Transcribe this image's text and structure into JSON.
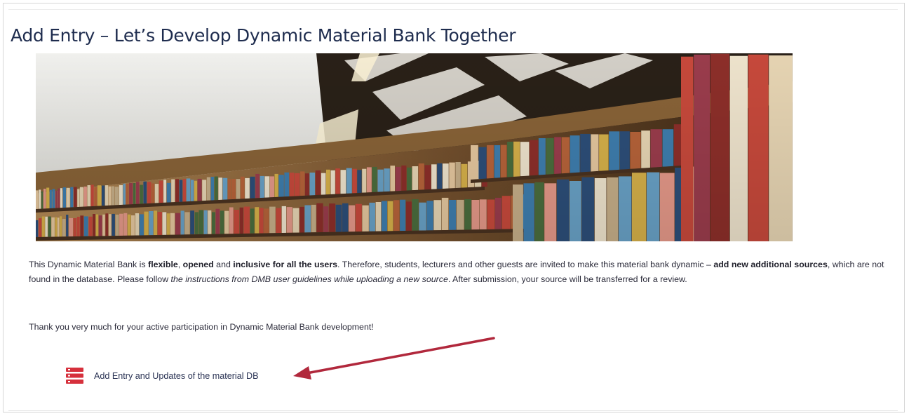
{
  "page": {
    "title": "Add Entry – Let’s Develop Dynamic Material Bank Together"
  },
  "banner": {
    "description": "library-bookshelf-photo",
    "colors": {
      "ceiling": "#ecece8",
      "wood": "#6b4a2b",
      "accent": "#c9a67a"
    }
  },
  "intro": {
    "p1": "This Dynamic Material Bank is ",
    "b1": "flexible",
    "p2": ", ",
    "b2": "opened",
    "p3": " and ",
    "b3": "inclusive for all the users",
    "p4": ". Therefore, students, lecturers and other guests are invited to make this material bank dynamic – ",
    "b4": "add new additional sources",
    "p5": ", which are not found in the database. Please follow ",
    "i1": "the instructions from DMB user guidelines while uploading a new source",
    "p6": ". After submission, your source will be transferred for a review."
  },
  "thanks": "Thank you very much for your active participation in Dynamic Material Bank development!",
  "entry_link": {
    "icon": "database-list-icon",
    "label": "Add Entry and Updates of the material DB",
    "icon_color": "#d6303c"
  },
  "annotation": {
    "arrow_color": "#b1283c"
  }
}
